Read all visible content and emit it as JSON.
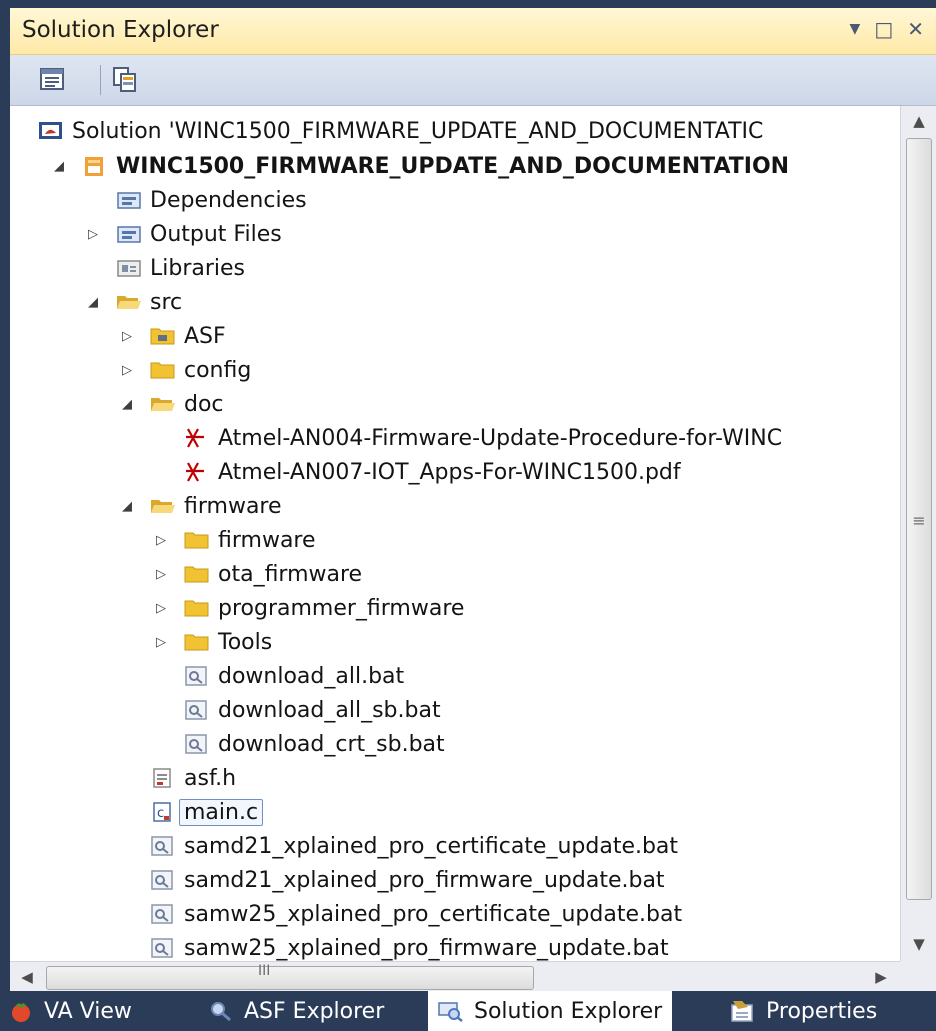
{
  "panel": {
    "title": "Solution Explorer",
    "dropdown_glyph": "▼",
    "maximize_glyph": "□",
    "close_glyph": "✕"
  },
  "toolbar": {
    "buttons": [
      {
        "name": "properties-icon"
      },
      {
        "name": "show-all-files-icon"
      }
    ]
  },
  "tree": {
    "items": [
      {
        "label": "Solution 'WINC1500_FIRMWARE_UPDATE_AND_DOCUMENTATIC",
        "icon": "solution-icon",
        "expander": ""
      },
      {
        "label": "WINC1500_FIRMWARE_UPDATE_AND_DOCUMENTATION",
        "icon": "project-icon",
        "expander": "◢"
      },
      {
        "label": "Dependencies",
        "icon": "reference-folder-icon",
        "expander": ""
      },
      {
        "label": "Output Files",
        "icon": "reference-folder-icon",
        "expander": "▷"
      },
      {
        "label": "Libraries",
        "icon": "library-icon",
        "expander": ""
      },
      {
        "label": "src",
        "icon": "folder-open-icon",
        "expander": "◢"
      },
      {
        "label": "ASF",
        "icon": "asf-folder-icon",
        "expander": "▷"
      },
      {
        "label": "config",
        "icon": "folder-icon",
        "expander": "▷"
      },
      {
        "label": "doc",
        "icon": "folder-open-icon",
        "expander": "◢"
      },
      {
        "label": "Atmel-AN004-Firmware-Update-Procedure-for-WINC",
        "icon": "pdf-icon",
        "expander": ""
      },
      {
        "label": "Atmel-AN007-IOT_Apps-For-WINC1500.pdf",
        "icon": "pdf-icon",
        "expander": ""
      },
      {
        "label": "firmware",
        "icon": "folder-open-icon",
        "expander": "◢"
      },
      {
        "label": "firmware",
        "icon": "folder-icon",
        "expander": "▷"
      },
      {
        "label": "ota_firmware",
        "icon": "folder-icon",
        "expander": "▷"
      },
      {
        "label": "programmer_firmware",
        "icon": "folder-icon",
        "expander": "▷"
      },
      {
        "label": "Tools",
        "icon": "folder-icon",
        "expander": "▷"
      },
      {
        "label": "download_all.bat",
        "icon": "batch-file-icon",
        "expander": ""
      },
      {
        "label": "download_all_sb.bat",
        "icon": "batch-file-icon",
        "expander": ""
      },
      {
        "label": "download_crt_sb.bat",
        "icon": "batch-file-icon",
        "expander": ""
      },
      {
        "label": "asf.h",
        "icon": "header-file-icon",
        "expander": ""
      },
      {
        "label": "main.c",
        "icon": "c-file-icon",
        "expander": ""
      },
      {
        "label": "samd21_xplained_pro_certificate_update.bat",
        "icon": "batch-file-icon",
        "expander": ""
      },
      {
        "label": "samd21_xplained_pro_firmware_update.bat",
        "icon": "batch-file-icon",
        "expander": ""
      },
      {
        "label": "samw25_xplained_pro_certificate_update.bat",
        "icon": "batch-file-icon",
        "expander": ""
      },
      {
        "label": "samw25_xplained_pro_firmware_update.bat",
        "icon": "batch-file-icon",
        "expander": ""
      }
    ],
    "selected": "main.c"
  },
  "scrollbars": {
    "up_glyph": "▲",
    "down_glyph": "▼",
    "left_glyph": "◀",
    "right_glyph": "▶",
    "v_grip": "≡",
    "h_grip": "III"
  },
  "tabs": [
    {
      "label": "VA View",
      "icon": "tomato-icon"
    },
    {
      "label": "ASF Explorer",
      "icon": "magnifier-icon"
    },
    {
      "label": "Solution Explorer",
      "icon": "solution-explorer-icon"
    },
    {
      "label": "Properties",
      "icon": "properties-tab-icon"
    }
  ],
  "colors": {
    "accent_title": "#ffe9a8",
    "tab_strip": "#2b3c59",
    "folder": "#f1c232",
    "pdf_red": "#c00000"
  }
}
